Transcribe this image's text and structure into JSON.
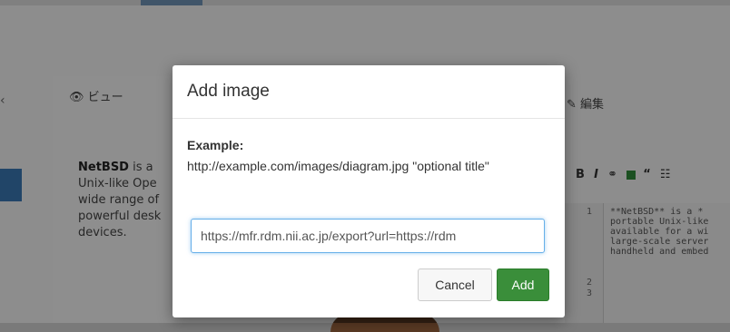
{
  "background": {
    "view_tab": "ビュー",
    "edit_tab": "編集",
    "content_lines": [
      "NetBSD is a",
      "Unix-like Ope",
      "wide range of",
      "powerful desk",
      "devices."
    ],
    "content_bold": "NetBSD",
    "toolbar": [
      "B",
      "I"
    ],
    "line_numbers": [
      "1",
      "2",
      "3"
    ],
    "code_lines": [
      "**NetBSD** is a *",
      "portable Unix-like",
      "available for a wi",
      "large-scale server",
      "handheld and embed"
    ]
  },
  "modal": {
    "title": "Add image",
    "example_label": "Example:",
    "example_text": "http://example.com/images/diagram.jpg \"optional title\"",
    "url_value": "https://mfr.rdm.nii.ac.jp/export?url=https://rdm",
    "cancel_label": "Cancel",
    "add_label": "Add"
  },
  "colors": {
    "accent_green": "#3a8e3a",
    "focus_blue": "#66afe9"
  }
}
